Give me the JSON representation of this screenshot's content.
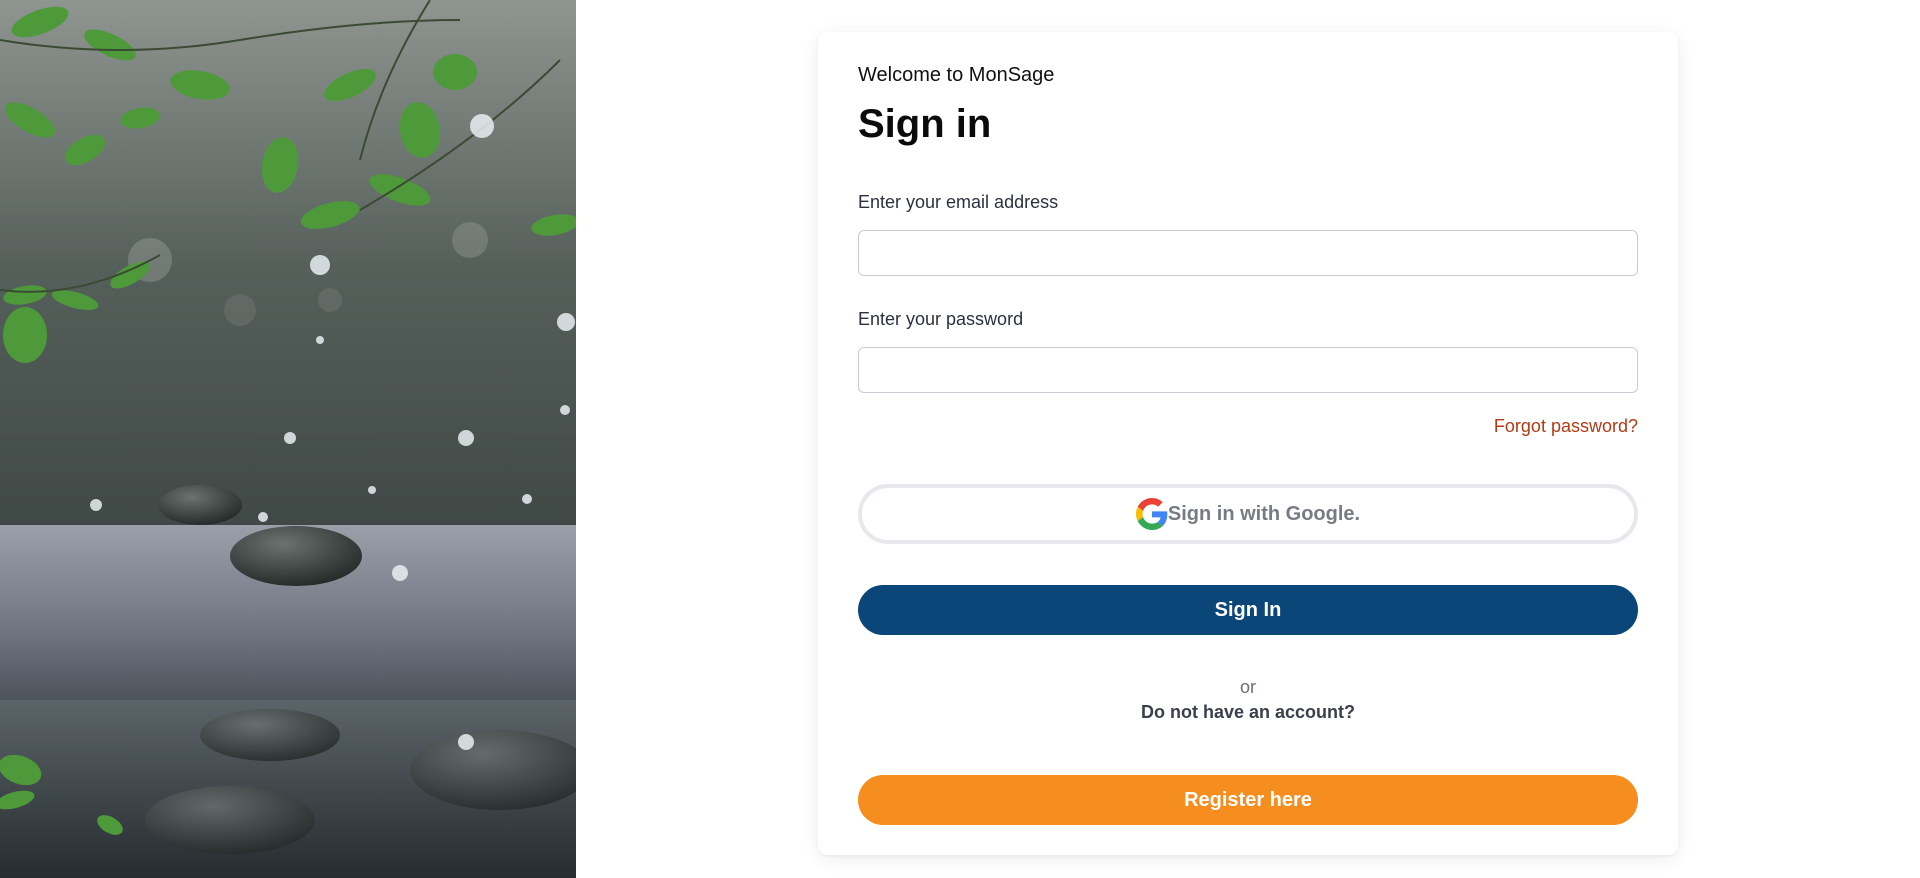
{
  "hero": {
    "image": "zen-stones-water-leaves-photo"
  },
  "login": {
    "welcome": "Welcome to MonSage",
    "title": "Sign in",
    "email_label": "Enter your email address",
    "email_value": "",
    "password_label": "Enter your password",
    "password_value": "",
    "forgot_password": "Forgot password?",
    "google_button": "Sign in with Google.",
    "signin_button": "Sign In",
    "or_text": "or",
    "no_account_text": "Do not have an account?",
    "register_button": "Register here"
  },
  "colors": {
    "primary": "#0a4677",
    "accent": "#f68d1f",
    "link": "#b23a14"
  },
  "icons": {
    "google": "google-icon"
  }
}
